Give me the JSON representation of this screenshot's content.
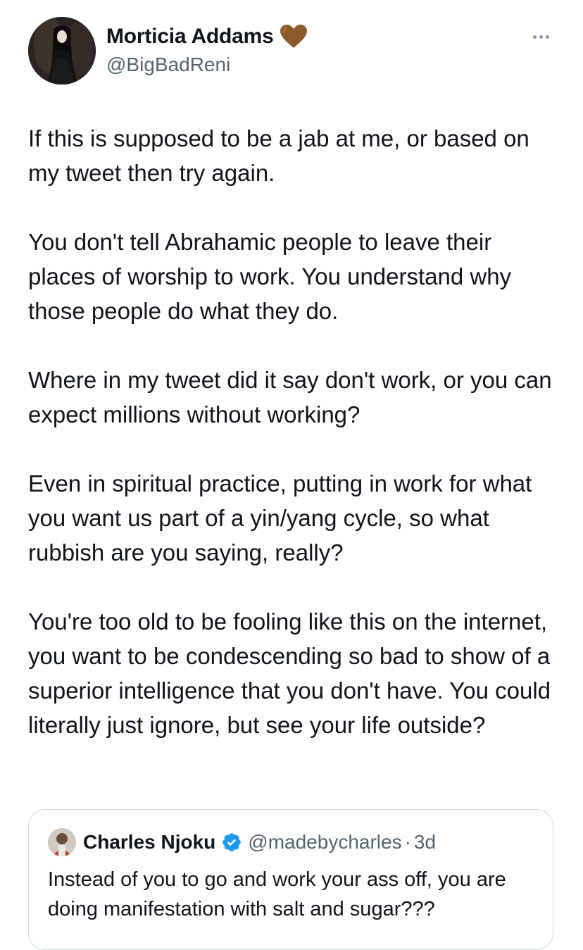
{
  "author": {
    "display_name": "Morticia Addams",
    "handle": "@BigBadReni",
    "name_emoji_icon": "brown-heart-icon",
    "emoji_color": "#8b5a2b"
  },
  "tweet": {
    "paragraphs": [
      "If this is supposed to be a jab at me, or based on my tweet then try again.",
      "You don't tell Abrahamic people to leave their places of worship to work. You understand why those people do what they do.",
      "Where in my tweet did it say don't work, or you can expect millions without working?",
      "Even in spiritual practice, putting in work for what you want us part of a yin/yang cycle, so what rubbish are you saying, really?",
      "You're too old to be fooling like this on the internet, you want to be condescending so bad to show of a superior intelligence that you don't have. You could literally just ignore, but see your life outside?"
    ]
  },
  "quoted_tweet": {
    "display_name": "Charles Njoku",
    "handle": "@madebycharles",
    "separator": "·",
    "time": "3d",
    "verified_icon": "verified-badge-icon",
    "verified_color": "#1d9bf0",
    "text": "Instead of you to go and work your ass off, you are doing manifestation with salt and sugar???"
  },
  "icons": {
    "more": "more-options-icon"
  },
  "colors": {
    "text_primary": "#0f1419",
    "text_secondary": "#536471",
    "border": "#cfd9de"
  }
}
